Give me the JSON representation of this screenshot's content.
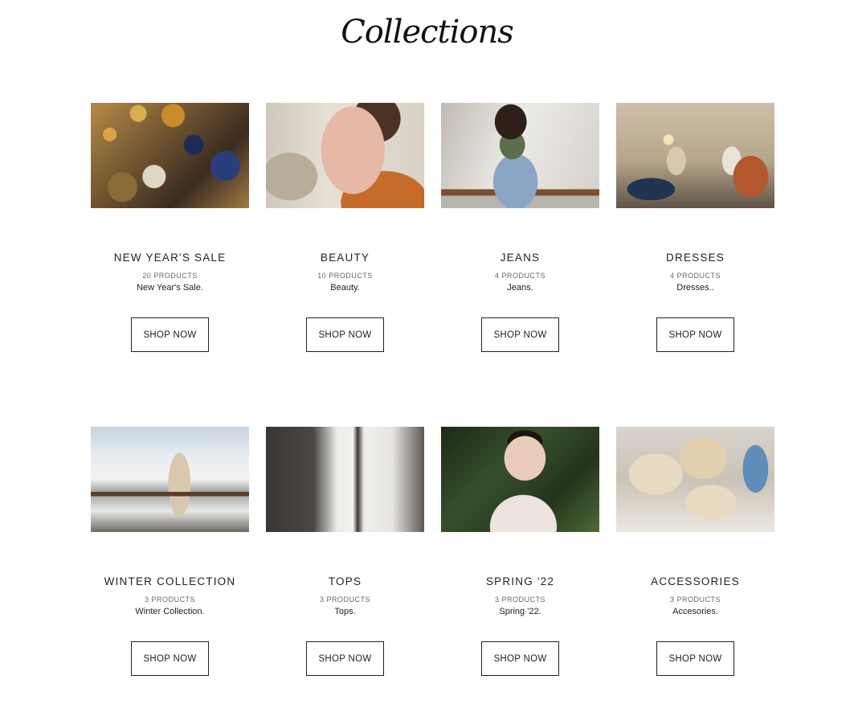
{
  "page": {
    "title": "Collections"
  },
  "collections": [
    {
      "title": "NEW YEAR'S SALE",
      "count": "20 PRODUCTS",
      "description": "New Year's Sale.",
      "button": "SHOP NOW"
    },
    {
      "title": "BEAUTY",
      "count": "10 PRODUCTS",
      "description": "Beauty.",
      "button": "SHOP NOW"
    },
    {
      "title": "JEANS",
      "count": "4 PRODUCTS",
      "description": "Jeans.",
      "button": "SHOP NOW"
    },
    {
      "title": "DRESSES",
      "count": "4 PRODUCTS",
      "description": "Dresses..",
      "button": "SHOP NOW"
    },
    {
      "title": "WINTER COLLECTION",
      "count": "3 PRODUCTS",
      "description": "Winter Collection.",
      "button": "SHOP NOW"
    },
    {
      "title": "TOPS",
      "count": "3 PRODUCTS",
      "description": "Tops.",
      "button": "SHOP NOW"
    },
    {
      "title": "SPRING '22",
      "count": "3 PRODUCTS",
      "description": "Spring '22.",
      "button": "SHOP NOW"
    },
    {
      "title": "ACCESSORIES",
      "count": "3 PRODUCTS",
      "description": "Accesories.",
      "button": "SHOP NOW"
    }
  ]
}
